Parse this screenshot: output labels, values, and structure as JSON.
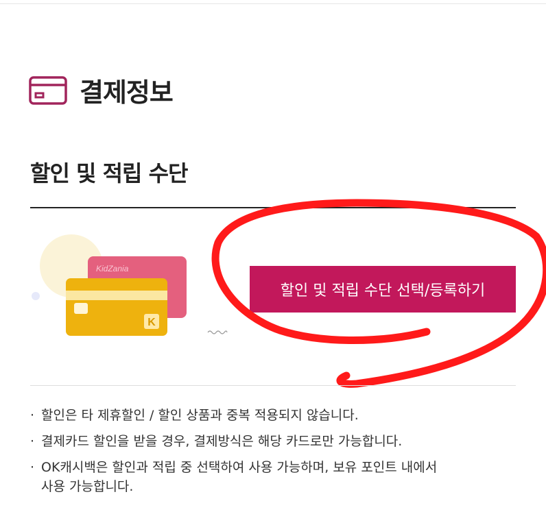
{
  "section": {
    "title": "결제정보",
    "icon": "credit-card-icon",
    "accent_color": "#a1245b"
  },
  "discount": {
    "title": "할인 및 적립 수단",
    "card_brand_text": "KidZania",
    "card_logo_letter": "K",
    "button_label": "할인 및 적립 수단 선택/등록하기",
    "button_color": "#c2185b",
    "annotation_color": "#ff1a1a"
  },
  "notes": [
    {
      "bullet": "·",
      "line1": "할인은 타 제휴할인 / 할인 상품과 중복 적용되지 않습니다.",
      "line2": ""
    },
    {
      "bullet": "·",
      "line1": "결제카드 할인을 받을 경우, 결제방식은 해당 카드로만 가능합니다.",
      "line2": ""
    },
    {
      "bullet": "·",
      "line1": "OK캐시백은 할인과 적립 중 선택하여 사용 가능하며, 보유 포인트 내에서",
      "line2": "사용 가능합니다."
    }
  ]
}
